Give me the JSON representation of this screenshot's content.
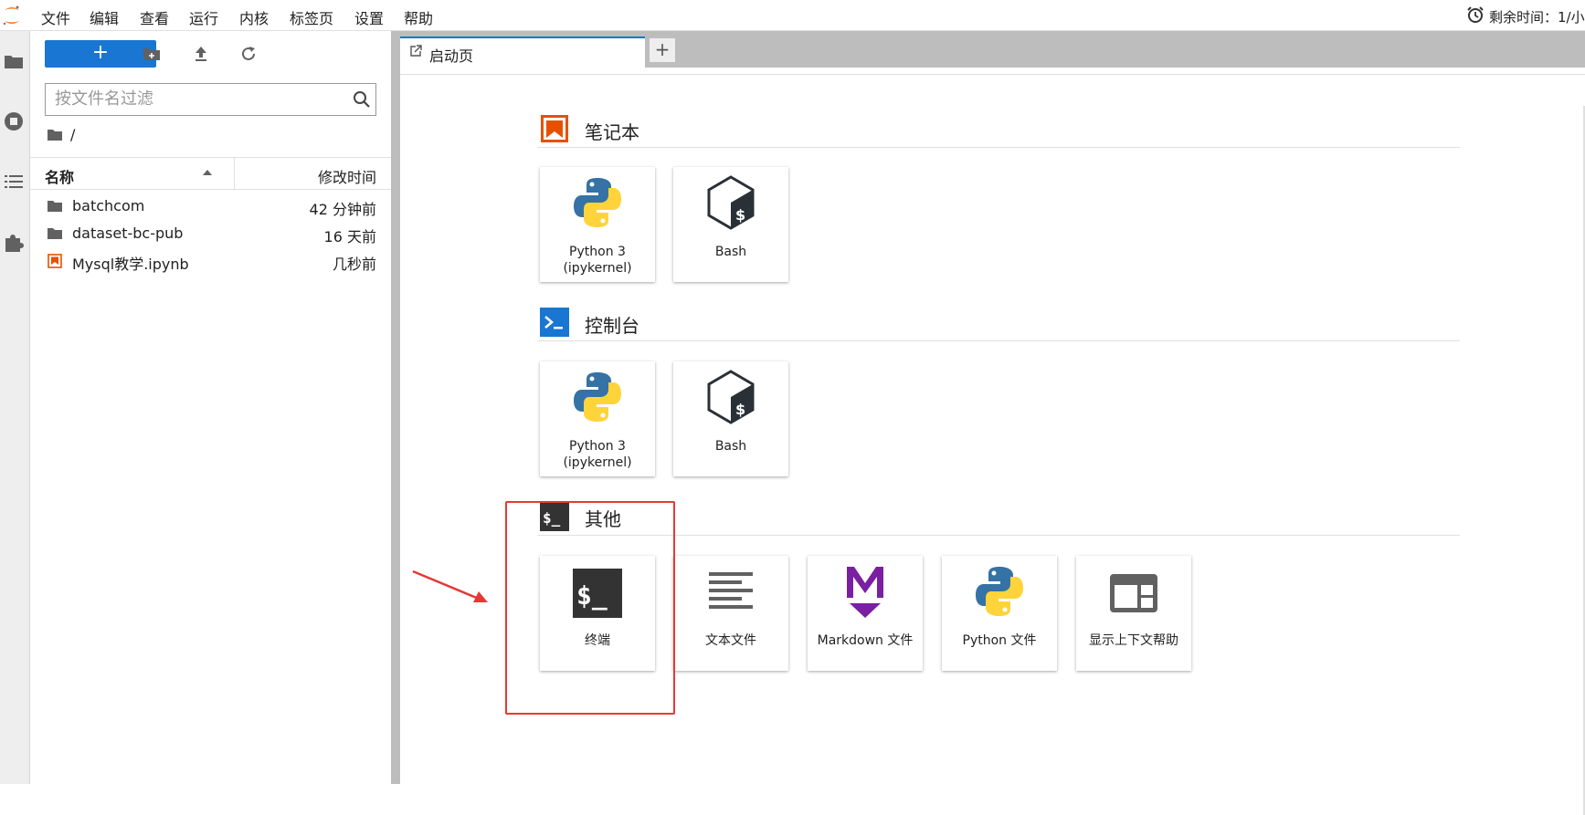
{
  "menubar": {
    "items": [
      "文件",
      "编辑",
      "查看",
      "运行",
      "内核",
      "标签页",
      "设置",
      "帮助"
    ],
    "timer_text": "剩余时间：1/小"
  },
  "filebrowser": {
    "new_label": "+",
    "filter_placeholder": "按文件名过滤",
    "breadcrumb": "/",
    "col_name": "名称",
    "col_modified": "修改时间",
    "files": [
      {
        "name": "batchcom",
        "modified": "42 分钟前",
        "icon": "folder-icon"
      },
      {
        "name": "dataset-bc-pub",
        "modified": "16 天前",
        "icon": "folder-icon"
      },
      {
        "name": "Mysql教学.ipynb",
        "modified": "几秒前",
        "icon": "notebook-icon"
      }
    ]
  },
  "tabs": {
    "launcher_label": "启动页",
    "add_label": "+"
  },
  "launcher": {
    "notebook": {
      "title": "笔记本",
      "cards": [
        {
          "label_line1": "Python 3",
          "label_line2": "(ipykernel)",
          "icon": "python-icon"
        },
        {
          "label_line1": "Bash",
          "label_line2": "",
          "icon": "bash-icon"
        }
      ]
    },
    "console": {
      "title": "控制台",
      "cards": [
        {
          "label_line1": "Python 3",
          "label_line2": "(ipykernel)",
          "icon": "python-icon"
        },
        {
          "label_line1": "Bash",
          "label_line2": "",
          "icon": "bash-icon"
        }
      ]
    },
    "other": {
      "title": "其他",
      "cards": [
        {
          "label": "终端",
          "icon": "terminal-icon"
        },
        {
          "label": "文本文件",
          "icon": "text-file-icon"
        },
        {
          "label": "Markdown 文件",
          "icon": "markdown-icon"
        },
        {
          "label": "Python 文件",
          "icon": "python-icon"
        },
        {
          "label": "显示上下文帮助",
          "icon": "context-help-icon"
        }
      ]
    }
  },
  "colors": {
    "accent": "#1976d2",
    "notebook_orange": "#e65100",
    "highlight_red": "#e53935"
  }
}
